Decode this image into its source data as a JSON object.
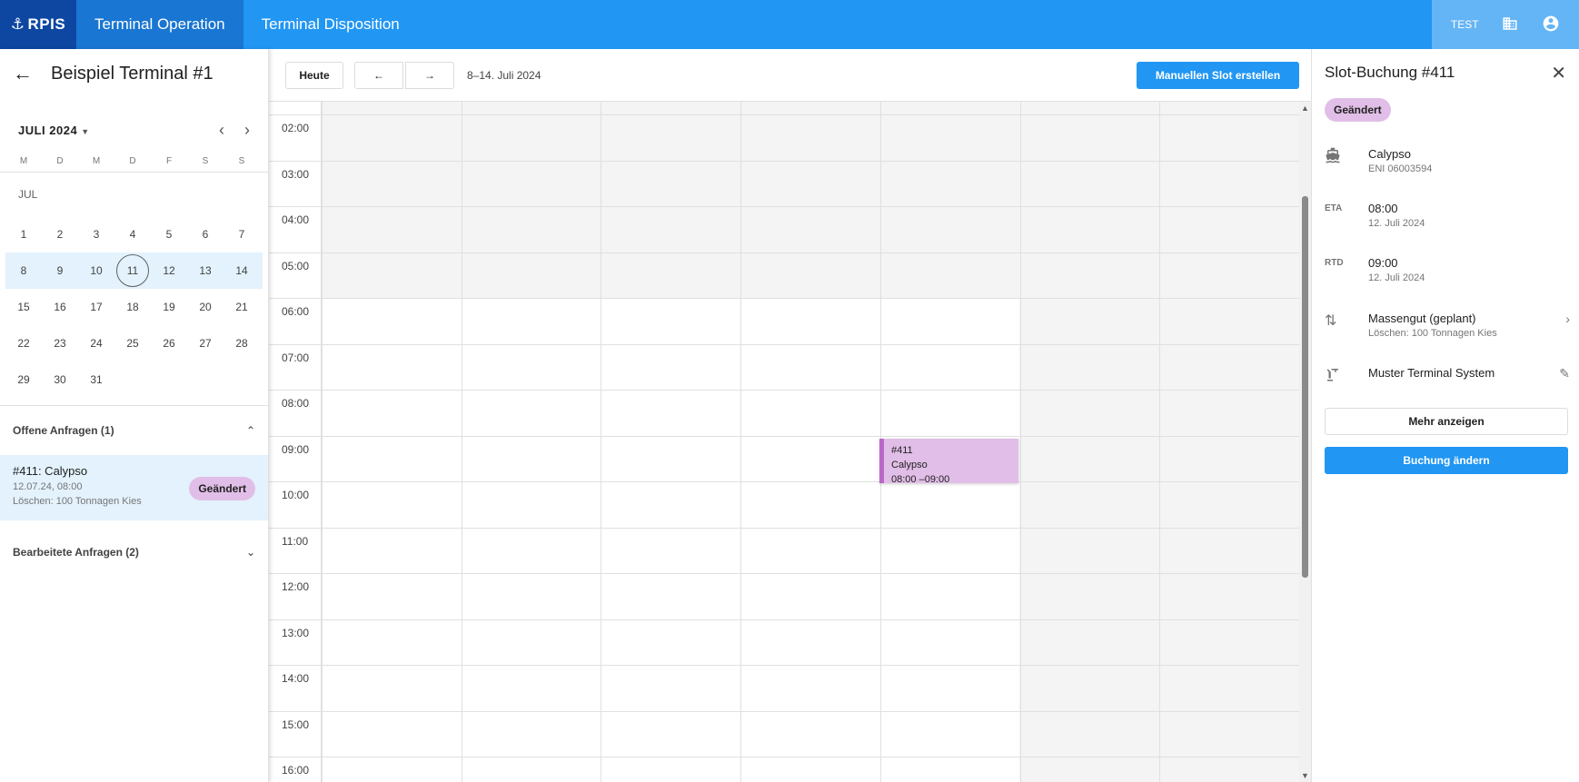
{
  "topbar": {
    "logo": "RPIS",
    "tabs": [
      "Terminal Operation",
      "Terminal Disposition"
    ],
    "env": "TEST"
  },
  "sidebar": {
    "title": "Beispiel Terminal #1",
    "month": "JULI 2024",
    "weekdays": [
      "M",
      "D",
      "M",
      "D",
      "F",
      "S",
      "S"
    ],
    "month_short": "JUL",
    "weeks": [
      [
        "1",
        "2",
        "3",
        "4",
        "5",
        "6",
        "7"
      ],
      [
        "8",
        "9",
        "10",
        "11",
        "12",
        "13",
        "14"
      ],
      [
        "15",
        "16",
        "17",
        "18",
        "19",
        "20",
        "21"
      ],
      [
        "22",
        "23",
        "24",
        "25",
        "26",
        "27",
        "28"
      ],
      [
        "29",
        "30",
        "31",
        "",
        "",
        "",
        ""
      ]
    ],
    "today": "11",
    "open_requests_label": "Offene Anfragen (1)",
    "request": {
      "title": "#411: Calypso",
      "date": "12.07.24, 08:00",
      "desc": "Löschen: 100 Tonnagen Kies",
      "badge": "Geändert"
    },
    "processed_requests_label": "Bearbeitete Anfragen (2)"
  },
  "calendar": {
    "today_button": "Heute",
    "range": "8–14. Juli 2024",
    "create_button": "Manuellen Slot erstellen",
    "hours": [
      "02:00",
      "03:00",
      "04:00",
      "05:00",
      "06:00",
      "07:00",
      "08:00",
      "09:00",
      "10:00",
      "11:00",
      "12:00",
      "13:00",
      "14:00",
      "15:00",
      "16:00"
    ],
    "event": {
      "id": "#411",
      "name": "Calypso",
      "time": "08:00 –09:00"
    }
  },
  "detail": {
    "title": "Slot-Buchung #411",
    "badge": "Geändert",
    "vessel_name": "Calypso",
    "vessel_eni": "ENI 06003594",
    "eta_label": "ETA",
    "eta_time": "08:00",
    "eta_date": "12. Juli 2024",
    "rtd_label": "RTD",
    "rtd_time": "09:00",
    "rtd_date": "12. Juli 2024",
    "cargo_type": "Massengut (geplant)",
    "cargo_desc": "Löschen: 100 Tonnagen Kies",
    "system": "Muster Terminal System",
    "more_button": "Mehr anzeigen",
    "change_button": "Buchung ändern"
  }
}
